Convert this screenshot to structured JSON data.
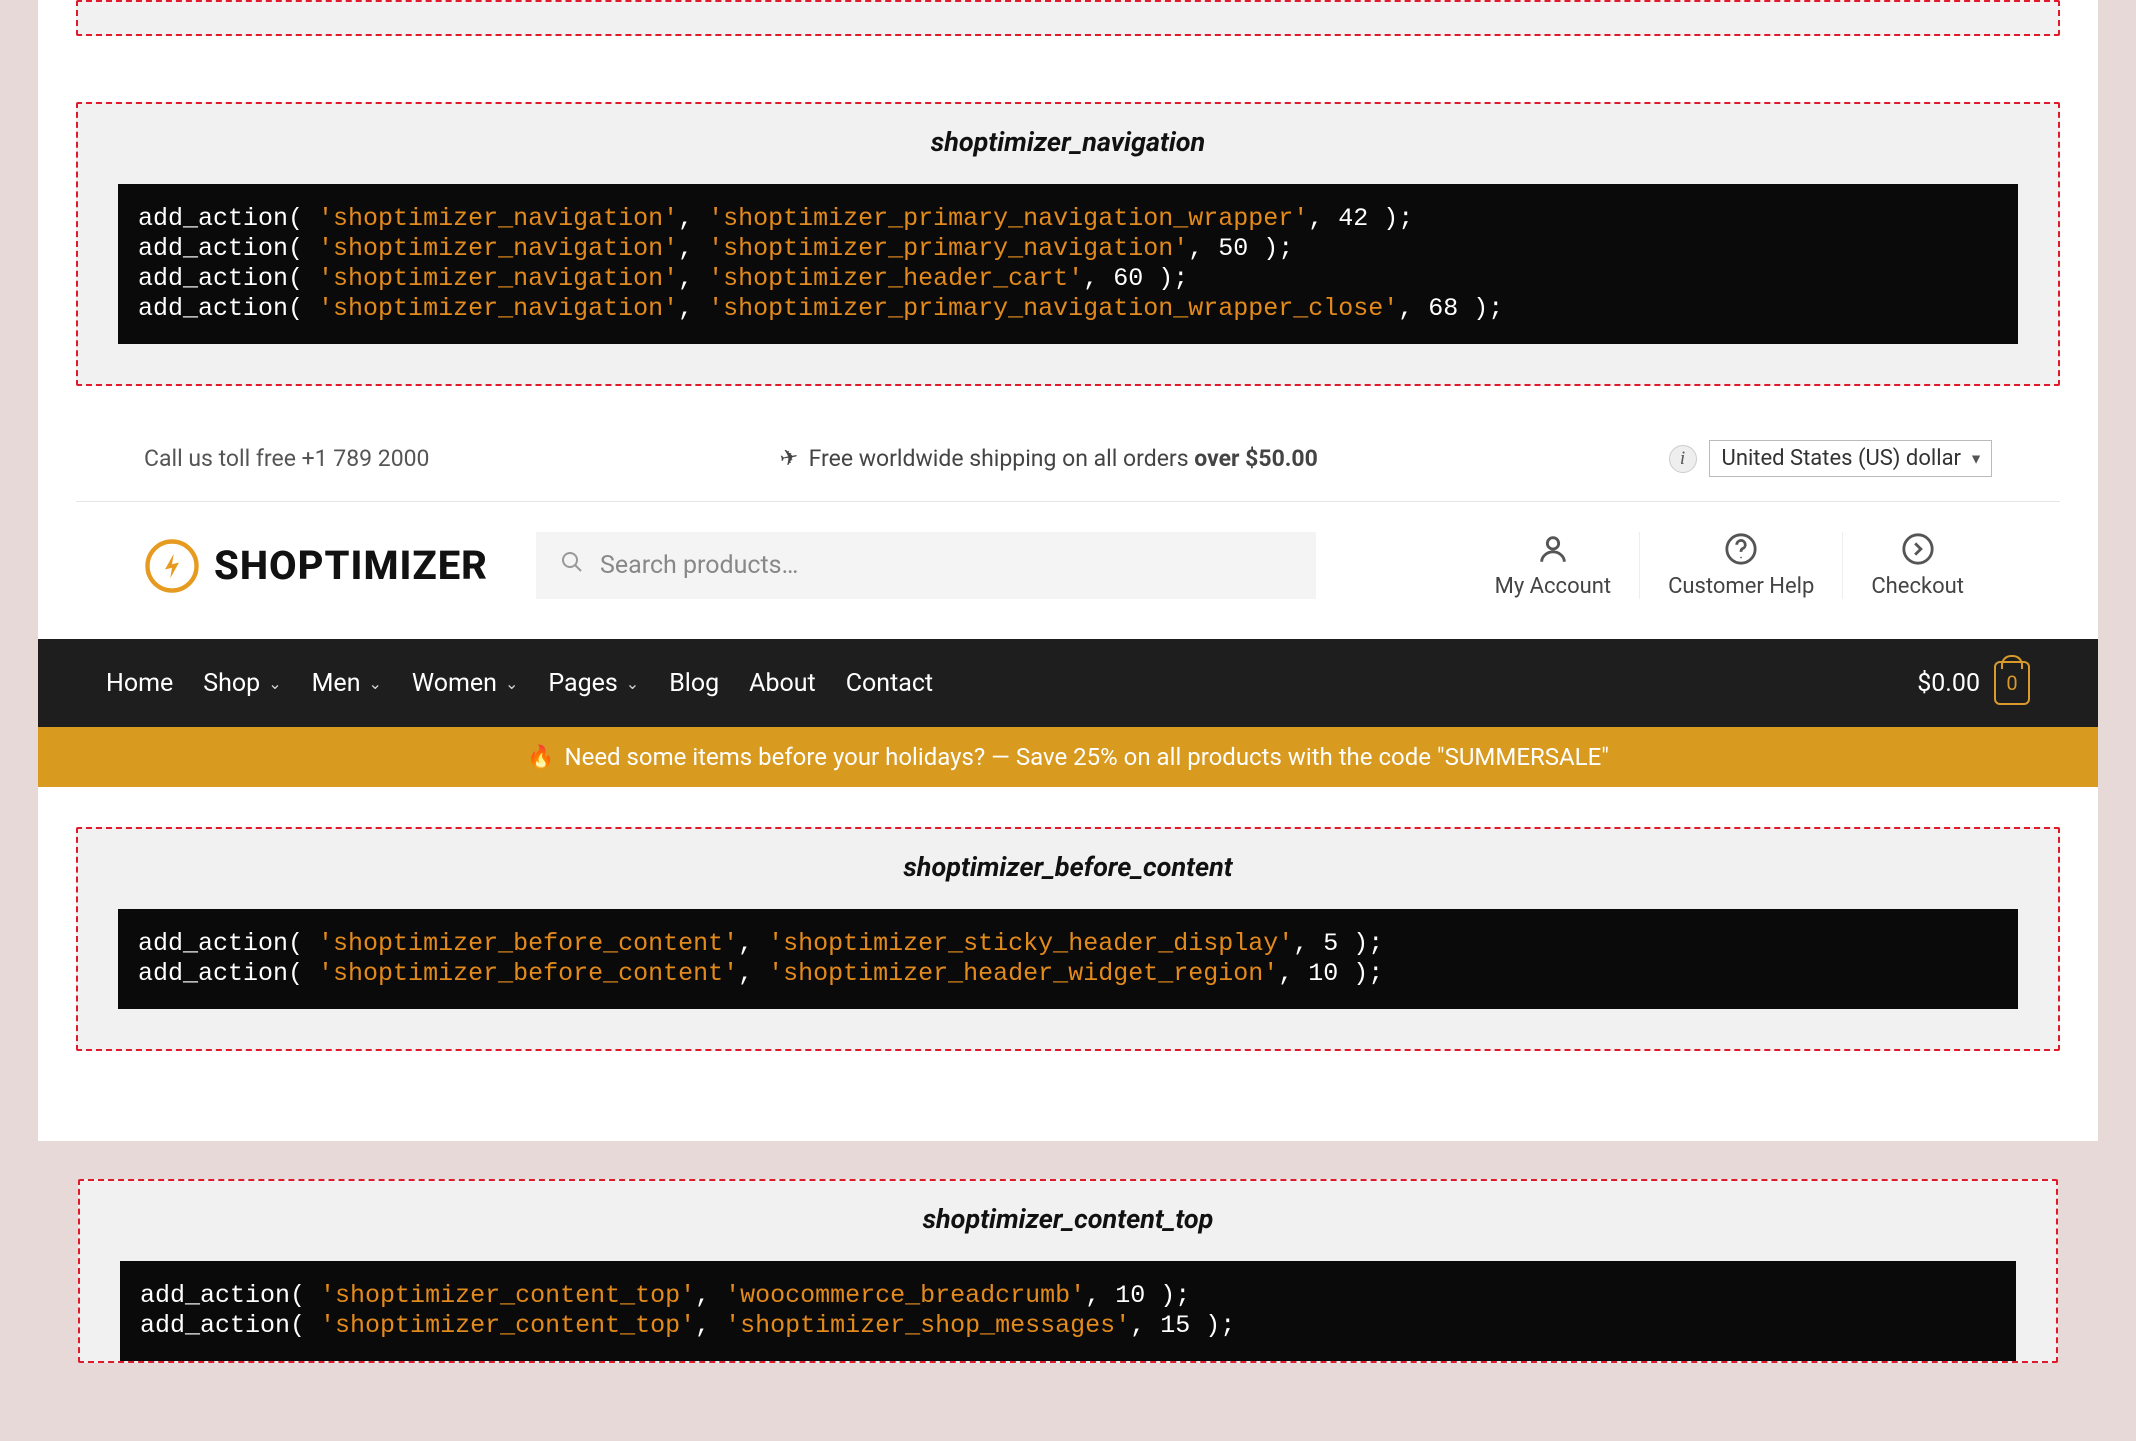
{
  "hooks": {
    "navigation": {
      "title": "shoptimizer_navigation",
      "lines": [
        {
          "hook": "shoptimizer_navigation",
          "cb": "shoptimizer_primary_navigation_wrapper",
          "pri": "42"
        },
        {
          "hook": "shoptimizer_navigation",
          "cb": "shoptimizer_primary_navigation",
          "pri": "50"
        },
        {
          "hook": "shoptimizer_navigation",
          "cb": "shoptimizer_header_cart",
          "pri": "60"
        },
        {
          "hook": "shoptimizer_navigation",
          "cb": "shoptimizer_primary_navigation_wrapper_close",
          "pri": "68"
        }
      ]
    },
    "before_content": {
      "title": "shoptimizer_before_content",
      "lines": [
        {
          "hook": "shoptimizer_before_content",
          "cb": "shoptimizer_sticky_header_display",
          "pri": "5"
        },
        {
          "hook": "shoptimizer_before_content",
          "cb": "shoptimizer_header_widget_region",
          "pri": "10"
        }
      ]
    },
    "content_top": {
      "title": "shoptimizer_content_top",
      "lines": [
        {
          "hook": "shoptimizer_content_top",
          "cb": "woocommerce_breadcrumb",
          "pri": "10"
        },
        {
          "hook": "shoptimizer_content_top",
          "cb": "shoptimizer_shop_messages",
          "pri": "15"
        }
      ]
    }
  },
  "topbar": {
    "left": "Call us toll free +1 789 2000",
    "center_prefix": "Free worldwide shipping on all orders ",
    "center_bold": "over $50.00",
    "currency": "United States (US) dollar"
  },
  "header": {
    "logo_text": "SHOPTIMIZER",
    "search_placeholder": "Search products…",
    "icons": [
      {
        "label": "My Account"
      },
      {
        "label": "Customer Help"
      },
      {
        "label": "Checkout"
      }
    ]
  },
  "nav": {
    "items": [
      {
        "label": "Home",
        "caret": false
      },
      {
        "label": "Shop",
        "caret": true
      },
      {
        "label": "Men",
        "caret": true
      },
      {
        "label": "Women",
        "caret": true
      },
      {
        "label": "Pages",
        "caret": true
      },
      {
        "label": "Blog",
        "caret": false
      },
      {
        "label": "About",
        "caret": false
      },
      {
        "label": "Contact",
        "caret": false
      }
    ],
    "cart_total": "$0.00",
    "cart_count": "0"
  },
  "promo": {
    "text": "Need some items before your holidays? — Save 25% on all products with the code \"SUMMERSALE\""
  }
}
